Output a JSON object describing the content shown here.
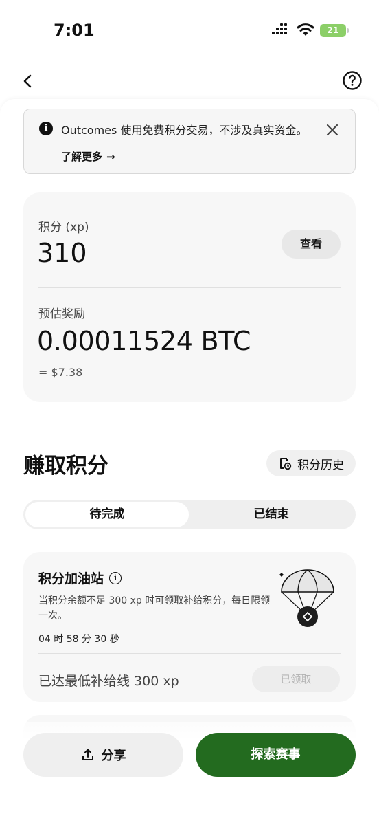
{
  "status_bar": {
    "time": "7:01",
    "battery": "21",
    "battery_color": "#8ccf68"
  },
  "nav": {
    "back_icon": "chevron-left-icon",
    "help_icon": "question-circle-icon"
  },
  "notice": {
    "text": "Outcomes 使用免费积分交易，不涉及真实资金。",
    "link_label": "了解更多",
    "link_arrow": "→",
    "close_icon": "close-icon"
  },
  "points": {
    "label": "积分 (xp)",
    "value": "310",
    "view_button": "查看",
    "reward_label": "预估奖励",
    "reward_value": "0.00011524 BTC",
    "reward_usd": "= $7.38"
  },
  "earn": {
    "title": "赚取积分",
    "history_button": "积分历史"
  },
  "tabs": [
    {
      "label": "待完成",
      "active": true
    },
    {
      "label": "已结束",
      "active": false
    }
  ],
  "task": {
    "title": "积分加油站",
    "description": "当积分余额不足 300 xp 时可领取补给积分，每日限领一次。",
    "timer": "04 时 58 分 30 秒",
    "threshold": "已达最低补给线 300 xp",
    "claim_button": "已领取"
  },
  "actions": {
    "share": "分享",
    "explore": "探索赛事",
    "explore_color": "#236b1f"
  }
}
